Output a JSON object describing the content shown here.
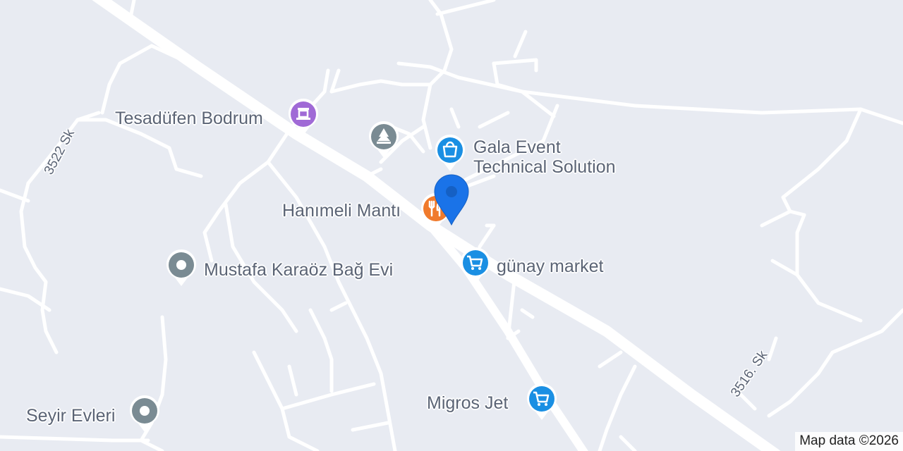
{
  "map": {
    "background_color": "#e8ebf2",
    "road_color": "#ffffff"
  },
  "streets": {
    "s3522": "3522 Sk",
    "s3516": "3516. Sk"
  },
  "pois": {
    "tesadufen": {
      "name": "Tesadüfen Bodrum",
      "icon": "museum-icon",
      "color": "#a06ad6"
    },
    "park": {
      "name": "",
      "icon": "park-tree-icon",
      "color": "#7a8b93"
    },
    "gala": {
      "name_line1": "Gala Event",
      "name_line2": "Technical Solution",
      "icon": "shopping-bag-icon",
      "color": "#1a8fe3"
    },
    "hanimeli": {
      "name": "Hanımeli Mantı",
      "icon": "restaurant-icon",
      "color": "#f07a2c"
    },
    "gunay": {
      "name": "günay market",
      "icon": "shopping-cart-icon",
      "color": "#1a8fe3"
    },
    "mustafa": {
      "name": "Mustafa Karaöz Bağ Evi",
      "icon": "place-icon",
      "color": "#7a8b93"
    },
    "migros": {
      "name": "Migros Jet",
      "icon": "shopping-cart-icon",
      "color": "#1a8fe3"
    },
    "seyir": {
      "name": "Seyir Evleri",
      "icon": "place-icon",
      "color": "#7a8b93"
    }
  },
  "location_marker": {
    "icon": "location-pin-icon",
    "color": "#1a73e8"
  },
  "attribution": "Map data ©2026"
}
